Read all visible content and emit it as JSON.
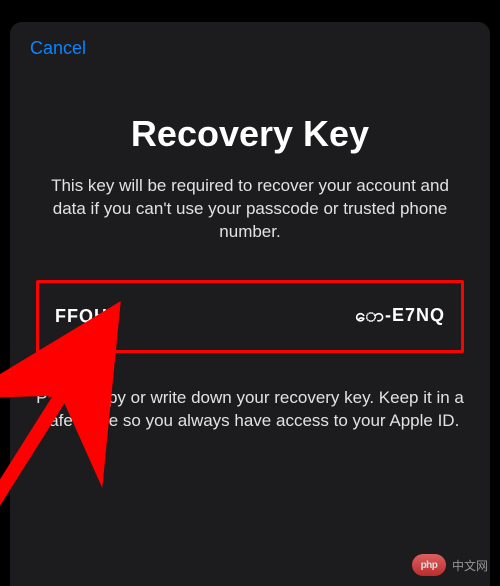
{
  "header": {
    "cancel_label": "Cancel"
  },
  "content": {
    "title": "Recovery Key",
    "subtitle": "This key will be required to recover your account and data if you can't use your passcode or trusted phone number.",
    "key_prefix": "FFQH-",
    "key_suffix": "ော-E7NQ",
    "hint_prefix": "P",
    "hint_rest": "t a copy or write down your recovery key. Keep it in a safe place so you always have access to your Apple ID."
  },
  "annotation": {
    "highlight_color": "#ff0000",
    "arrow_color": "#ff0000"
  },
  "watermark": {
    "logo_text": "php",
    "site_text": "中文网"
  }
}
